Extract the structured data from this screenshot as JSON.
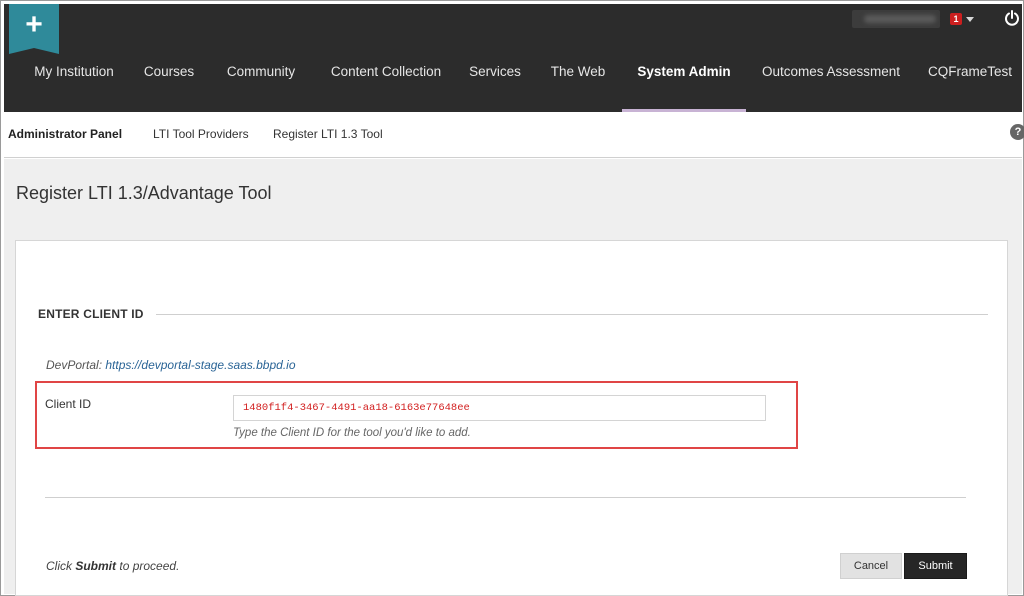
{
  "header": {
    "logo_icon": "plus-icon",
    "notification_count": "1",
    "power_icon": "power-icon"
  },
  "nav": {
    "items": [
      {
        "label": "My Institution"
      },
      {
        "label": "Courses"
      },
      {
        "label": "Community"
      },
      {
        "label": "Content Collection"
      },
      {
        "label": "Services"
      },
      {
        "label": "The Web"
      },
      {
        "label": "System Admin",
        "active": true
      },
      {
        "label": "Outcomes Assessment"
      },
      {
        "label": "CQFrameTest"
      }
    ],
    "active_underline_color": "#c8b3d4"
  },
  "breadcrumb": {
    "items": [
      {
        "label": "Administrator Panel"
      },
      {
        "label": "LTI Tool Providers"
      },
      {
        "label": "Register LTI 1.3 Tool"
      }
    ],
    "help_label": "?"
  },
  "page": {
    "title": "Register LTI 1.3/Advantage Tool"
  },
  "form": {
    "section_heading": "ENTER CLIENT ID",
    "devportal_label": "DevPortal:",
    "devportal_link": "https://devportal-stage.saas.bbpd.io",
    "client_id_label": "Client ID",
    "client_id_value": "1480f1f4-3467-4491-aa18-6163e77648ee",
    "client_id_hint": "Type the Client ID for the tool you'd like to add.",
    "proceed_prefix": "Click",
    "proceed_bold": "Submit",
    "proceed_suffix": "to proceed.",
    "cancel_label": "Cancel",
    "submit_label": "Submit",
    "highlight_color": "#e04545",
    "value_color": "#d22020"
  }
}
